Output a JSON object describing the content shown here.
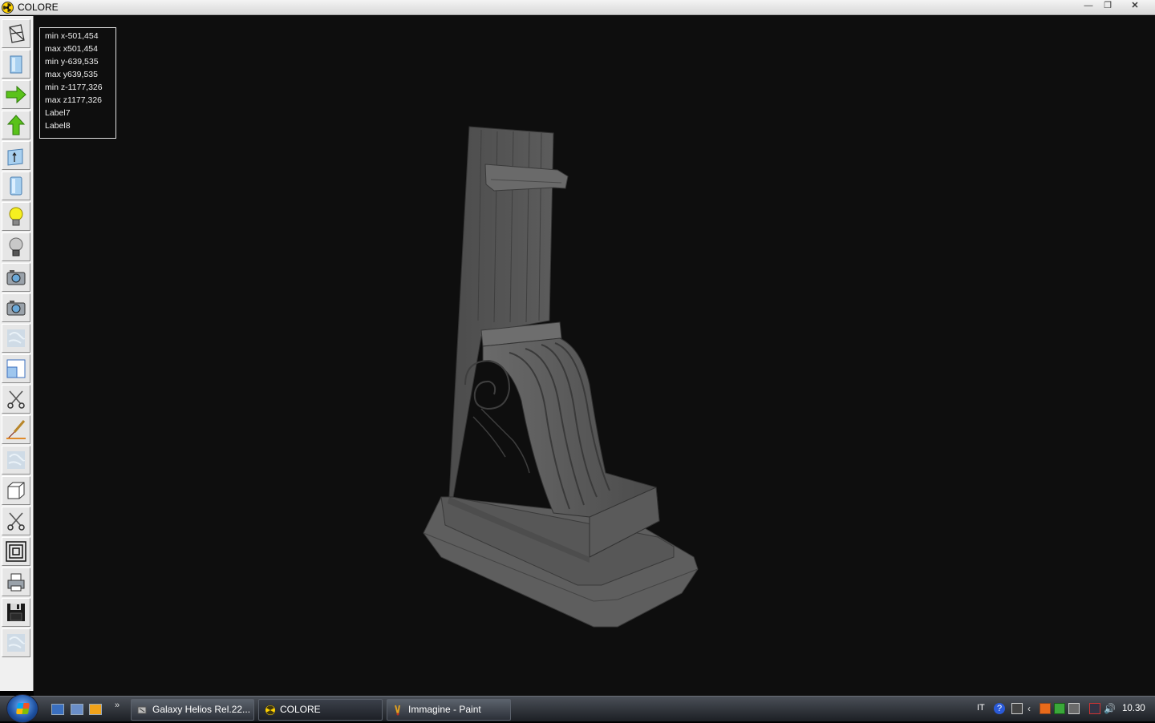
{
  "window": {
    "title": "COLORE",
    "minimize": "—",
    "maximize": "❐",
    "close": "✕"
  },
  "toolbar": {
    "tools": [
      {
        "name": "wireframe-view"
      },
      {
        "name": "solid-view"
      },
      {
        "name": "move-right"
      },
      {
        "name": "move-up"
      },
      {
        "name": "extrude"
      },
      {
        "name": "solid-box"
      },
      {
        "name": "light-on"
      },
      {
        "name": "light-off"
      },
      {
        "name": "camera"
      },
      {
        "name": "camera-2"
      },
      {
        "name": "texture"
      },
      {
        "name": "viewport-split"
      },
      {
        "name": "cut"
      },
      {
        "name": "paint-brush"
      },
      {
        "name": "texture-2"
      },
      {
        "name": "cube"
      },
      {
        "name": "cut-2"
      },
      {
        "name": "frames"
      },
      {
        "name": "print"
      },
      {
        "name": "save"
      },
      {
        "name": "texture-3"
      }
    ]
  },
  "info": {
    "lines": [
      "min x-501,454",
      "max x501,454",
      "min y-639,535",
      "max y639,535",
      "min z-1177,326",
      "max z1177,326",
      "Label7",
      "Label8"
    ]
  },
  "taskbar": {
    "more": "»",
    "tasks": [
      {
        "label": "Galaxy Helios  Rel.22..."
      },
      {
        "label": "COLORE"
      },
      {
        "label": "Immagine - Paint"
      }
    ],
    "tray": {
      "lang": "IT",
      "help": "?",
      "clock": "10.30"
    }
  },
  "colors": {
    "viewport": "#0e0e0e",
    "model": "#5a5a5a",
    "taskbar": "#1c1f24"
  }
}
